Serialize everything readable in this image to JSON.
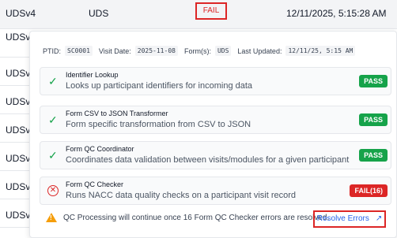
{
  "table": {
    "rows": [
      {
        "module": "UDSv4",
        "form": "UDS",
        "status": "FAIL",
        "timestamp": "12/11/2025, 5:15:28 AM"
      },
      {
        "module": "UDSv"
      },
      {
        "module": "UDSv"
      },
      {
        "module": "UDSv"
      },
      {
        "module": "UDSv"
      },
      {
        "module": "UDSv"
      },
      {
        "module": "UDSv"
      },
      {
        "module": "UDSv"
      }
    ]
  },
  "popover": {
    "ptid_label": "PTID:",
    "ptid": "SC0001",
    "visit_date_label": "Visit Date:",
    "visit_date": "2025-11-08",
    "forms_label": "Form(s):",
    "forms": "UDS",
    "updated_label": "Last Updated:",
    "updated": "12/11/25, 5:15 AM",
    "checks": [
      {
        "title": "Identifier Lookup",
        "desc": "Looks up participant identifiers for incoming data",
        "status": "PASS"
      },
      {
        "title": "Form CSV to JSON Transformer",
        "desc": "Form specific transformation from CSV to JSON",
        "status": "PASS"
      },
      {
        "title": "Form QC Coordinator",
        "desc": "Coordinates data validation between visits/modules for a given participant",
        "status": "PASS"
      },
      {
        "title": "Form QC Checker",
        "desc": "Runs NACC data quality checks on a participant visit record",
        "status": "FAIL(16)"
      }
    ],
    "warning": "QC Processing will continue once 16 Form QC Checker errors are resolved.",
    "resolve_label": "Resolve Errors",
    "colors": {
      "pass": "#16a34a",
      "fail": "#dc2626",
      "link": "#2563eb",
      "warning": "#f59e0b"
    }
  }
}
